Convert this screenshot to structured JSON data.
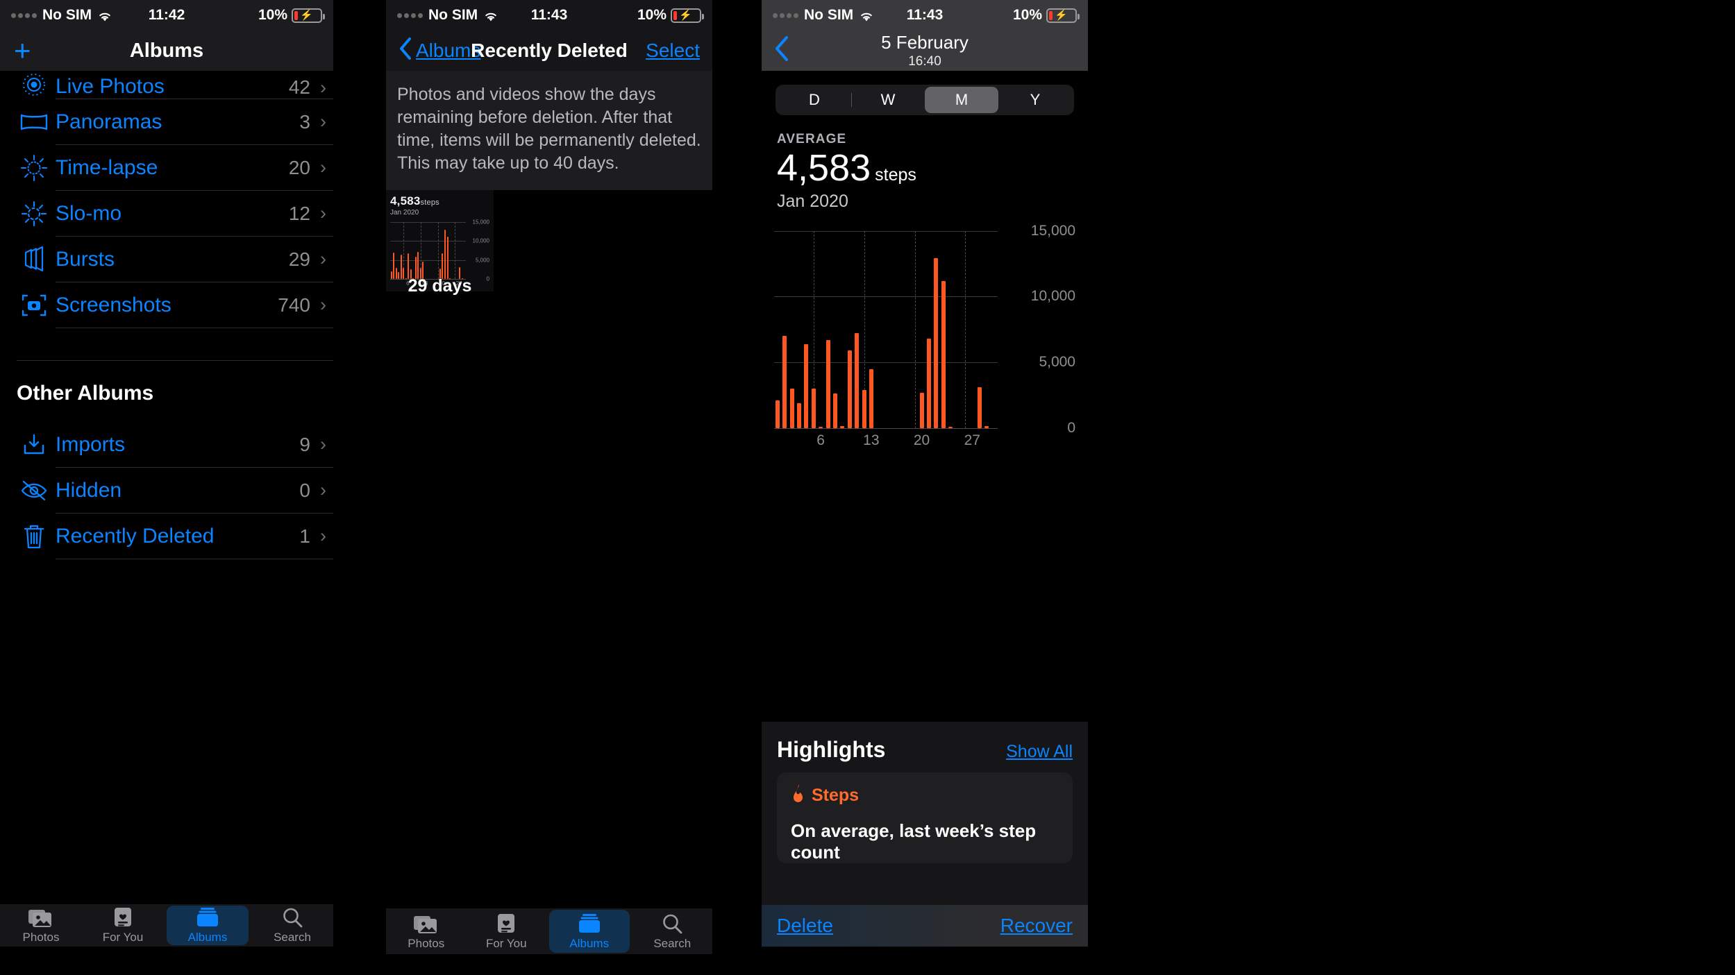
{
  "panel_photos": {
    "status": {
      "carrier": "No SIM",
      "time": "11:42",
      "battery": "10%"
    },
    "nav": {
      "add_label": "+",
      "title": "Albums"
    },
    "media_types": [
      {
        "icon": "live-photos-icon",
        "label": "Live Photos",
        "count": "42"
      },
      {
        "icon": "panoramas-icon",
        "label": "Panoramas",
        "count": "3"
      },
      {
        "icon": "time-lapse-icon",
        "label": "Time-lapse",
        "count": "20"
      },
      {
        "icon": "slo-mo-icon",
        "label": "Slo-mo",
        "count": "12"
      },
      {
        "icon": "bursts-icon",
        "label": "Bursts",
        "count": "29"
      },
      {
        "icon": "screenshots-icon",
        "label": "Screenshots",
        "count": "740"
      }
    ],
    "other_albums_header": "Other Albums",
    "other_albums": [
      {
        "icon": "imports-icon",
        "label": "Imports",
        "count": "9"
      },
      {
        "icon": "hidden-icon",
        "label": "Hidden",
        "count": "0"
      },
      {
        "icon": "trash-icon",
        "label": "Recently Deleted",
        "count": "1"
      }
    ],
    "tabs": [
      {
        "icon": "photos-icon",
        "label": "Photos",
        "active": false
      },
      {
        "icon": "for-you-icon",
        "label": "For You",
        "active": false
      },
      {
        "icon": "albums-icon",
        "label": "Albums",
        "active": true
      },
      {
        "icon": "search-icon",
        "label": "Search",
        "active": false
      }
    ]
  },
  "panel_deleted": {
    "status": {
      "carrier": "No SIM",
      "time": "11:43",
      "battery": "10%"
    },
    "nav": {
      "back_label": "Albums",
      "title": "Recently Deleted",
      "select_label": "Select"
    },
    "banner": "Photos and videos show the days remaining before deletion. After that time, items will be permanently deleted. This may take up to 40 days.",
    "widget": {
      "value": "4,583",
      "unit": "steps",
      "period": "Jan 2020",
      "caption": "29 days"
    },
    "tabs": [
      {
        "icon": "photos-icon",
        "label": "Photos",
        "active": false
      },
      {
        "icon": "for-you-icon",
        "label": "For You",
        "active": false
      },
      {
        "icon": "albums-icon",
        "label": "Albums",
        "active": true
      },
      {
        "icon": "search-icon",
        "label": "Search",
        "active": false
      }
    ]
  },
  "panel_health": {
    "status": {
      "carrier": "No SIM",
      "time": "11:43",
      "battery": "10%"
    },
    "nav": {
      "date": "5 February",
      "time": "16:40"
    },
    "segments": [
      {
        "label": "D",
        "selected": false
      },
      {
        "label": "W",
        "selected": false
      },
      {
        "label": "M",
        "selected": true
      },
      {
        "label": "Y",
        "selected": false
      }
    ],
    "average": {
      "label": "AVERAGE",
      "value": "4,583",
      "unit": "steps",
      "period": "Jan 2020"
    },
    "highlights": {
      "title": "Highlights",
      "show_all": "Show All",
      "item": {
        "metric_icon": "flame-icon",
        "metric": "Steps",
        "text": "On average, last week’s step count"
      }
    },
    "actions": {
      "delete": "Delete",
      "recover": "Recover"
    }
  },
  "chart_data": [
    {
      "id": "health-steps-month",
      "type": "bar",
      "title": "4,583 steps",
      "subtitle": "Jan 2020",
      "xlabel": "",
      "ylabel": "steps",
      "ylim": [
        0,
        15000
      ],
      "yticks": [
        0,
        5000,
        10000,
        15000
      ],
      "ytick_labels": [
        "0",
        "5,000",
        "10,000",
        "15,000"
      ],
      "xticks": [
        6,
        13,
        20,
        27
      ],
      "xtick_labels": [
        "6",
        "13",
        "20",
        "27"
      ],
      "grid": true,
      "bar_color": "#ff5722",
      "categories": [
        1,
        2,
        3,
        4,
        5,
        6,
        7,
        8,
        9,
        10,
        11,
        12,
        13,
        14,
        15,
        16,
        17,
        18,
        19,
        20,
        21,
        22,
        23,
        24,
        25,
        26,
        27,
        28,
        29,
        30,
        31
      ],
      "values": [
        2100,
        7000,
        3000,
        1900,
        6400,
        3000,
        60,
        6700,
        2600,
        120,
        5900,
        7200,
        2900,
        4500,
        0,
        0,
        0,
        0,
        0,
        0,
        2700,
        6800,
        12900,
        11200,
        60,
        0,
        0,
        0,
        3100,
        150,
        0
      ]
    },
    {
      "id": "deleted-widget-steps",
      "type": "bar",
      "title": "4,583 steps",
      "subtitle": "Jan 2020",
      "xlabel": "29 days",
      "ylabel": "steps",
      "ylim": [
        0,
        15000
      ],
      "yticks": [
        0,
        5000,
        10000,
        15000
      ],
      "ytick_labels": [
        "0",
        "5,000",
        "10,000",
        "15,000"
      ],
      "xticks": [
        6,
        13,
        20,
        27
      ],
      "xtick_labels": [
        "6",
        "13",
        "20",
        "27"
      ],
      "grid": true,
      "bar_color": "#ff5722",
      "categories": [
        1,
        2,
        3,
        4,
        5,
        6,
        7,
        8,
        9,
        10,
        11,
        12,
        13,
        14,
        15,
        16,
        17,
        18,
        19,
        20,
        21,
        22,
        23,
        24,
        25,
        26,
        27,
        28,
        29,
        30,
        31
      ],
      "values": [
        2100,
        7000,
        3000,
        1900,
        6400,
        3000,
        60,
        6700,
        2600,
        120,
        5900,
        7200,
        2900,
        4500,
        0,
        0,
        0,
        0,
        0,
        0,
        2700,
        6800,
        12900,
        11200,
        60,
        0,
        0,
        0,
        3100,
        150,
        0
      ]
    }
  ]
}
